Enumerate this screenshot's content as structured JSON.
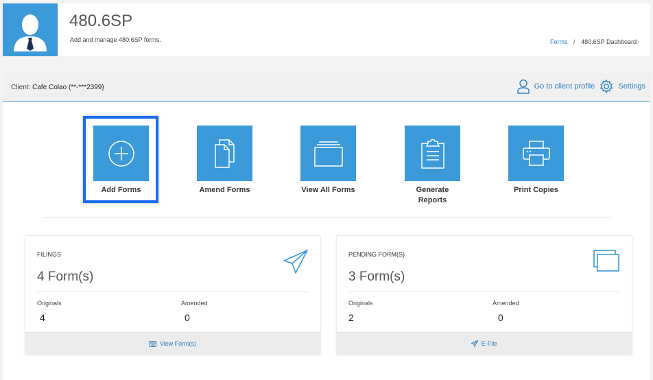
{
  "header": {
    "title": "480.6SP",
    "subtitle": "Add and manage 480.6SP forms.",
    "breadcrumb": {
      "link": "Forms",
      "separator": "/",
      "current": "480.6SP Dashboard"
    }
  },
  "client": {
    "label": "Client:",
    "name": "Cafe Colao (**-***2399)",
    "profile_link": "Go to client profile",
    "settings_link": "Settings"
  },
  "tiles": [
    {
      "label": "Add Forms",
      "icon": "plus-circle-icon"
    },
    {
      "label": "Amend Forms",
      "icon": "documents-icon"
    },
    {
      "label": "View All Forms",
      "icon": "folder-stack-icon"
    },
    {
      "label": "Generate Reports",
      "icon": "clipboard-icon"
    },
    {
      "label": "Print Copies",
      "icon": "printer-icon"
    }
  ],
  "cards": {
    "filings": {
      "title": "FILINGS",
      "count": "4 Form(s)",
      "originals_label": "Originals",
      "originals_value": "4",
      "amended_label": "Amended",
      "amended_value": "0",
      "footer": "View Form(s)",
      "icon": "paper-plane-icon"
    },
    "pending": {
      "title": "PENDING FORM(S)",
      "count": "3 Form(s)",
      "originals_label": "Originals",
      "originals_value": "2",
      "amended_label": "Amended",
      "amended_value": "0",
      "footer": "E-File",
      "icon": "windows-icon"
    }
  },
  "colors": {
    "accent": "#3b9ad9",
    "highlight": "#1a6cf0",
    "link": "#2a7fc0"
  }
}
